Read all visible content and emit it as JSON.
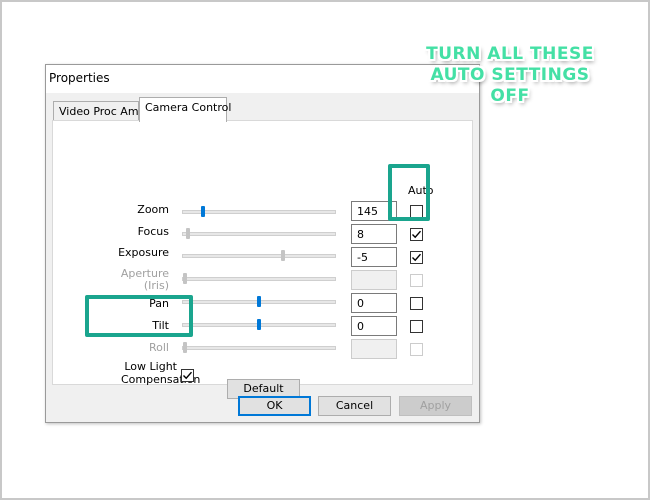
{
  "window": {
    "title": "Properties"
  },
  "tabs": [
    {
      "label": "Video Proc Amp",
      "active": false
    },
    {
      "label": "Camera Control",
      "active": true
    }
  ],
  "auto_header": "Auto",
  "controls": [
    {
      "label": "Zoom",
      "value": "145",
      "level": 0.12,
      "enabled": true,
      "auto_checked": false
    },
    {
      "label": "Focus",
      "value": "8",
      "level": 0.02,
      "enabled": true,
      "auto_checked": true
    },
    {
      "label": "Exposure",
      "value": "-5",
      "level": 0.66,
      "enabled": true,
      "auto_checked": true
    },
    {
      "label": "Aperture\n(Iris)",
      "value": "",
      "level": 0.0,
      "enabled": false,
      "auto_checked": false
    },
    {
      "label": "Pan",
      "value": "0",
      "level": 0.5,
      "enabled": true,
      "auto_checked": false
    },
    {
      "label": "Tilt",
      "value": "0",
      "level": 0.5,
      "enabled": true,
      "auto_checked": false
    },
    {
      "label": "Roll",
      "value": "",
      "level": 0.0,
      "enabled": false,
      "auto_checked": false
    }
  ],
  "low_light": {
    "label": "Low Light\nCompensation",
    "checked": true
  },
  "buttons": {
    "default": "Default",
    "ok": "OK",
    "cancel": "Cancel",
    "apply": "Apply"
  },
  "annotation": {
    "text": "TURN ALL THESE\nAUTO SETTINGS\nOFF"
  },
  "colors": {
    "accent": "#0078d7",
    "highlight": "#1aa58e",
    "annotation": "#44e0a5"
  }
}
